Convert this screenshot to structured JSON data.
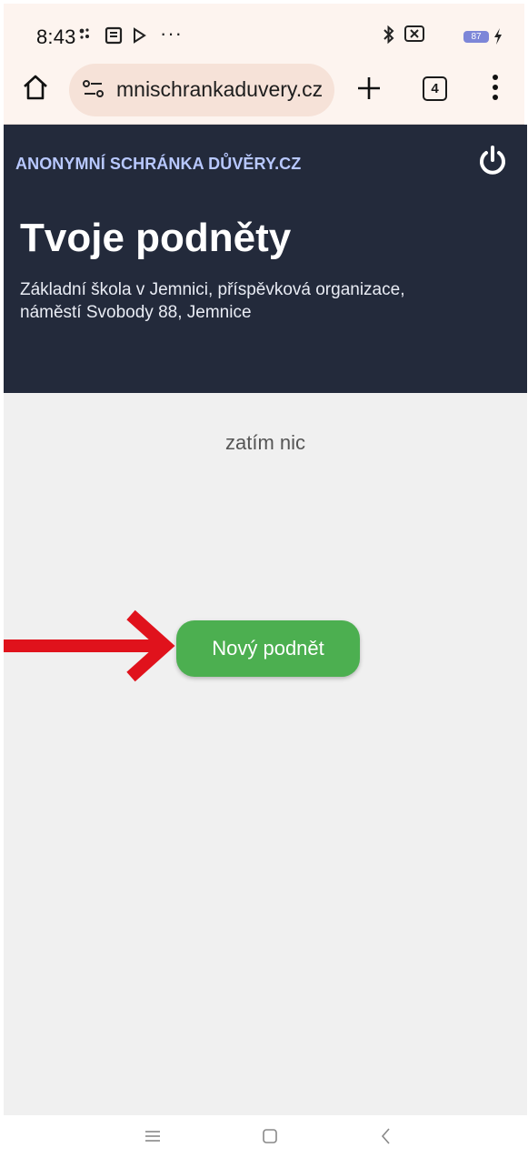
{
  "status_bar": {
    "time": "8:43",
    "more": "···",
    "battery": "87"
  },
  "browser": {
    "url": "mnischrankaduvery.cz",
    "tab_count": "4"
  },
  "header": {
    "brand": "ANONYMNÍ SCHRÁNKA DŮVĚRY.CZ",
    "title": "Tvoje podněty",
    "org_line1": "Základní škola v Jemnici, příspěvková organizace,",
    "org_line2": "náměstí Svobody 88, Jemnice"
  },
  "main": {
    "empty_text": "zatím nic",
    "new_button_label": "Nový podnět"
  },
  "colors": {
    "header_bg": "#232a3b",
    "brand_text": "#b8c8ff",
    "button_green": "#4caf50",
    "arrow_red": "#e0121c"
  }
}
